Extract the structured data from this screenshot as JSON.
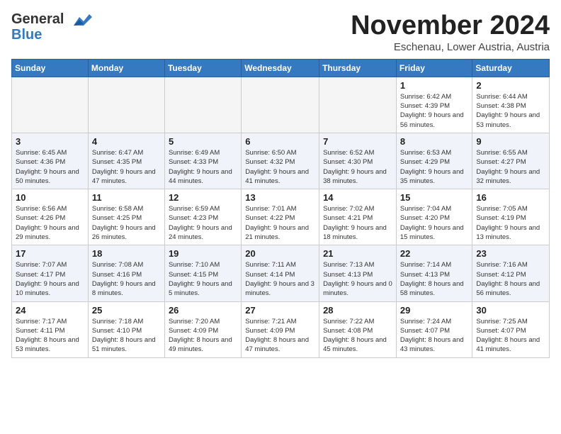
{
  "header": {
    "logo_line1": "General",
    "logo_line2": "Blue",
    "month_title": "November 2024",
    "location": "Eschenau, Lower Austria, Austria"
  },
  "days_of_week": [
    "Sunday",
    "Monday",
    "Tuesday",
    "Wednesday",
    "Thursday",
    "Friday",
    "Saturday"
  ],
  "weeks": [
    [
      {
        "day": "",
        "info": ""
      },
      {
        "day": "",
        "info": ""
      },
      {
        "day": "",
        "info": ""
      },
      {
        "day": "",
        "info": ""
      },
      {
        "day": "",
        "info": ""
      },
      {
        "day": "1",
        "info": "Sunrise: 6:42 AM\nSunset: 4:39 PM\nDaylight: 9 hours and 56 minutes."
      },
      {
        "day": "2",
        "info": "Sunrise: 6:44 AM\nSunset: 4:38 PM\nDaylight: 9 hours and 53 minutes."
      }
    ],
    [
      {
        "day": "3",
        "info": "Sunrise: 6:45 AM\nSunset: 4:36 PM\nDaylight: 9 hours and 50 minutes."
      },
      {
        "day": "4",
        "info": "Sunrise: 6:47 AM\nSunset: 4:35 PM\nDaylight: 9 hours and 47 minutes."
      },
      {
        "day": "5",
        "info": "Sunrise: 6:49 AM\nSunset: 4:33 PM\nDaylight: 9 hours and 44 minutes."
      },
      {
        "day": "6",
        "info": "Sunrise: 6:50 AM\nSunset: 4:32 PM\nDaylight: 9 hours and 41 minutes."
      },
      {
        "day": "7",
        "info": "Sunrise: 6:52 AM\nSunset: 4:30 PM\nDaylight: 9 hours and 38 minutes."
      },
      {
        "day": "8",
        "info": "Sunrise: 6:53 AM\nSunset: 4:29 PM\nDaylight: 9 hours and 35 minutes."
      },
      {
        "day": "9",
        "info": "Sunrise: 6:55 AM\nSunset: 4:27 PM\nDaylight: 9 hours and 32 minutes."
      }
    ],
    [
      {
        "day": "10",
        "info": "Sunrise: 6:56 AM\nSunset: 4:26 PM\nDaylight: 9 hours and 29 minutes."
      },
      {
        "day": "11",
        "info": "Sunrise: 6:58 AM\nSunset: 4:25 PM\nDaylight: 9 hours and 26 minutes."
      },
      {
        "day": "12",
        "info": "Sunrise: 6:59 AM\nSunset: 4:23 PM\nDaylight: 9 hours and 24 minutes."
      },
      {
        "day": "13",
        "info": "Sunrise: 7:01 AM\nSunset: 4:22 PM\nDaylight: 9 hours and 21 minutes."
      },
      {
        "day": "14",
        "info": "Sunrise: 7:02 AM\nSunset: 4:21 PM\nDaylight: 9 hours and 18 minutes."
      },
      {
        "day": "15",
        "info": "Sunrise: 7:04 AM\nSunset: 4:20 PM\nDaylight: 9 hours and 15 minutes."
      },
      {
        "day": "16",
        "info": "Sunrise: 7:05 AM\nSunset: 4:19 PM\nDaylight: 9 hours and 13 minutes."
      }
    ],
    [
      {
        "day": "17",
        "info": "Sunrise: 7:07 AM\nSunset: 4:17 PM\nDaylight: 9 hours and 10 minutes."
      },
      {
        "day": "18",
        "info": "Sunrise: 7:08 AM\nSunset: 4:16 PM\nDaylight: 9 hours and 8 minutes."
      },
      {
        "day": "19",
        "info": "Sunrise: 7:10 AM\nSunset: 4:15 PM\nDaylight: 9 hours and 5 minutes."
      },
      {
        "day": "20",
        "info": "Sunrise: 7:11 AM\nSunset: 4:14 PM\nDaylight: 9 hours and 3 minutes."
      },
      {
        "day": "21",
        "info": "Sunrise: 7:13 AM\nSunset: 4:13 PM\nDaylight: 9 hours and 0 minutes."
      },
      {
        "day": "22",
        "info": "Sunrise: 7:14 AM\nSunset: 4:13 PM\nDaylight: 8 hours and 58 minutes."
      },
      {
        "day": "23",
        "info": "Sunrise: 7:16 AM\nSunset: 4:12 PM\nDaylight: 8 hours and 56 minutes."
      }
    ],
    [
      {
        "day": "24",
        "info": "Sunrise: 7:17 AM\nSunset: 4:11 PM\nDaylight: 8 hours and 53 minutes."
      },
      {
        "day": "25",
        "info": "Sunrise: 7:18 AM\nSunset: 4:10 PM\nDaylight: 8 hours and 51 minutes."
      },
      {
        "day": "26",
        "info": "Sunrise: 7:20 AM\nSunset: 4:09 PM\nDaylight: 8 hours and 49 minutes."
      },
      {
        "day": "27",
        "info": "Sunrise: 7:21 AM\nSunset: 4:09 PM\nDaylight: 8 hours and 47 minutes."
      },
      {
        "day": "28",
        "info": "Sunrise: 7:22 AM\nSunset: 4:08 PM\nDaylight: 8 hours and 45 minutes."
      },
      {
        "day": "29",
        "info": "Sunrise: 7:24 AM\nSunset: 4:07 PM\nDaylight: 8 hours and 43 minutes."
      },
      {
        "day": "30",
        "info": "Sunrise: 7:25 AM\nSunset: 4:07 PM\nDaylight: 8 hours and 41 minutes."
      }
    ]
  ]
}
